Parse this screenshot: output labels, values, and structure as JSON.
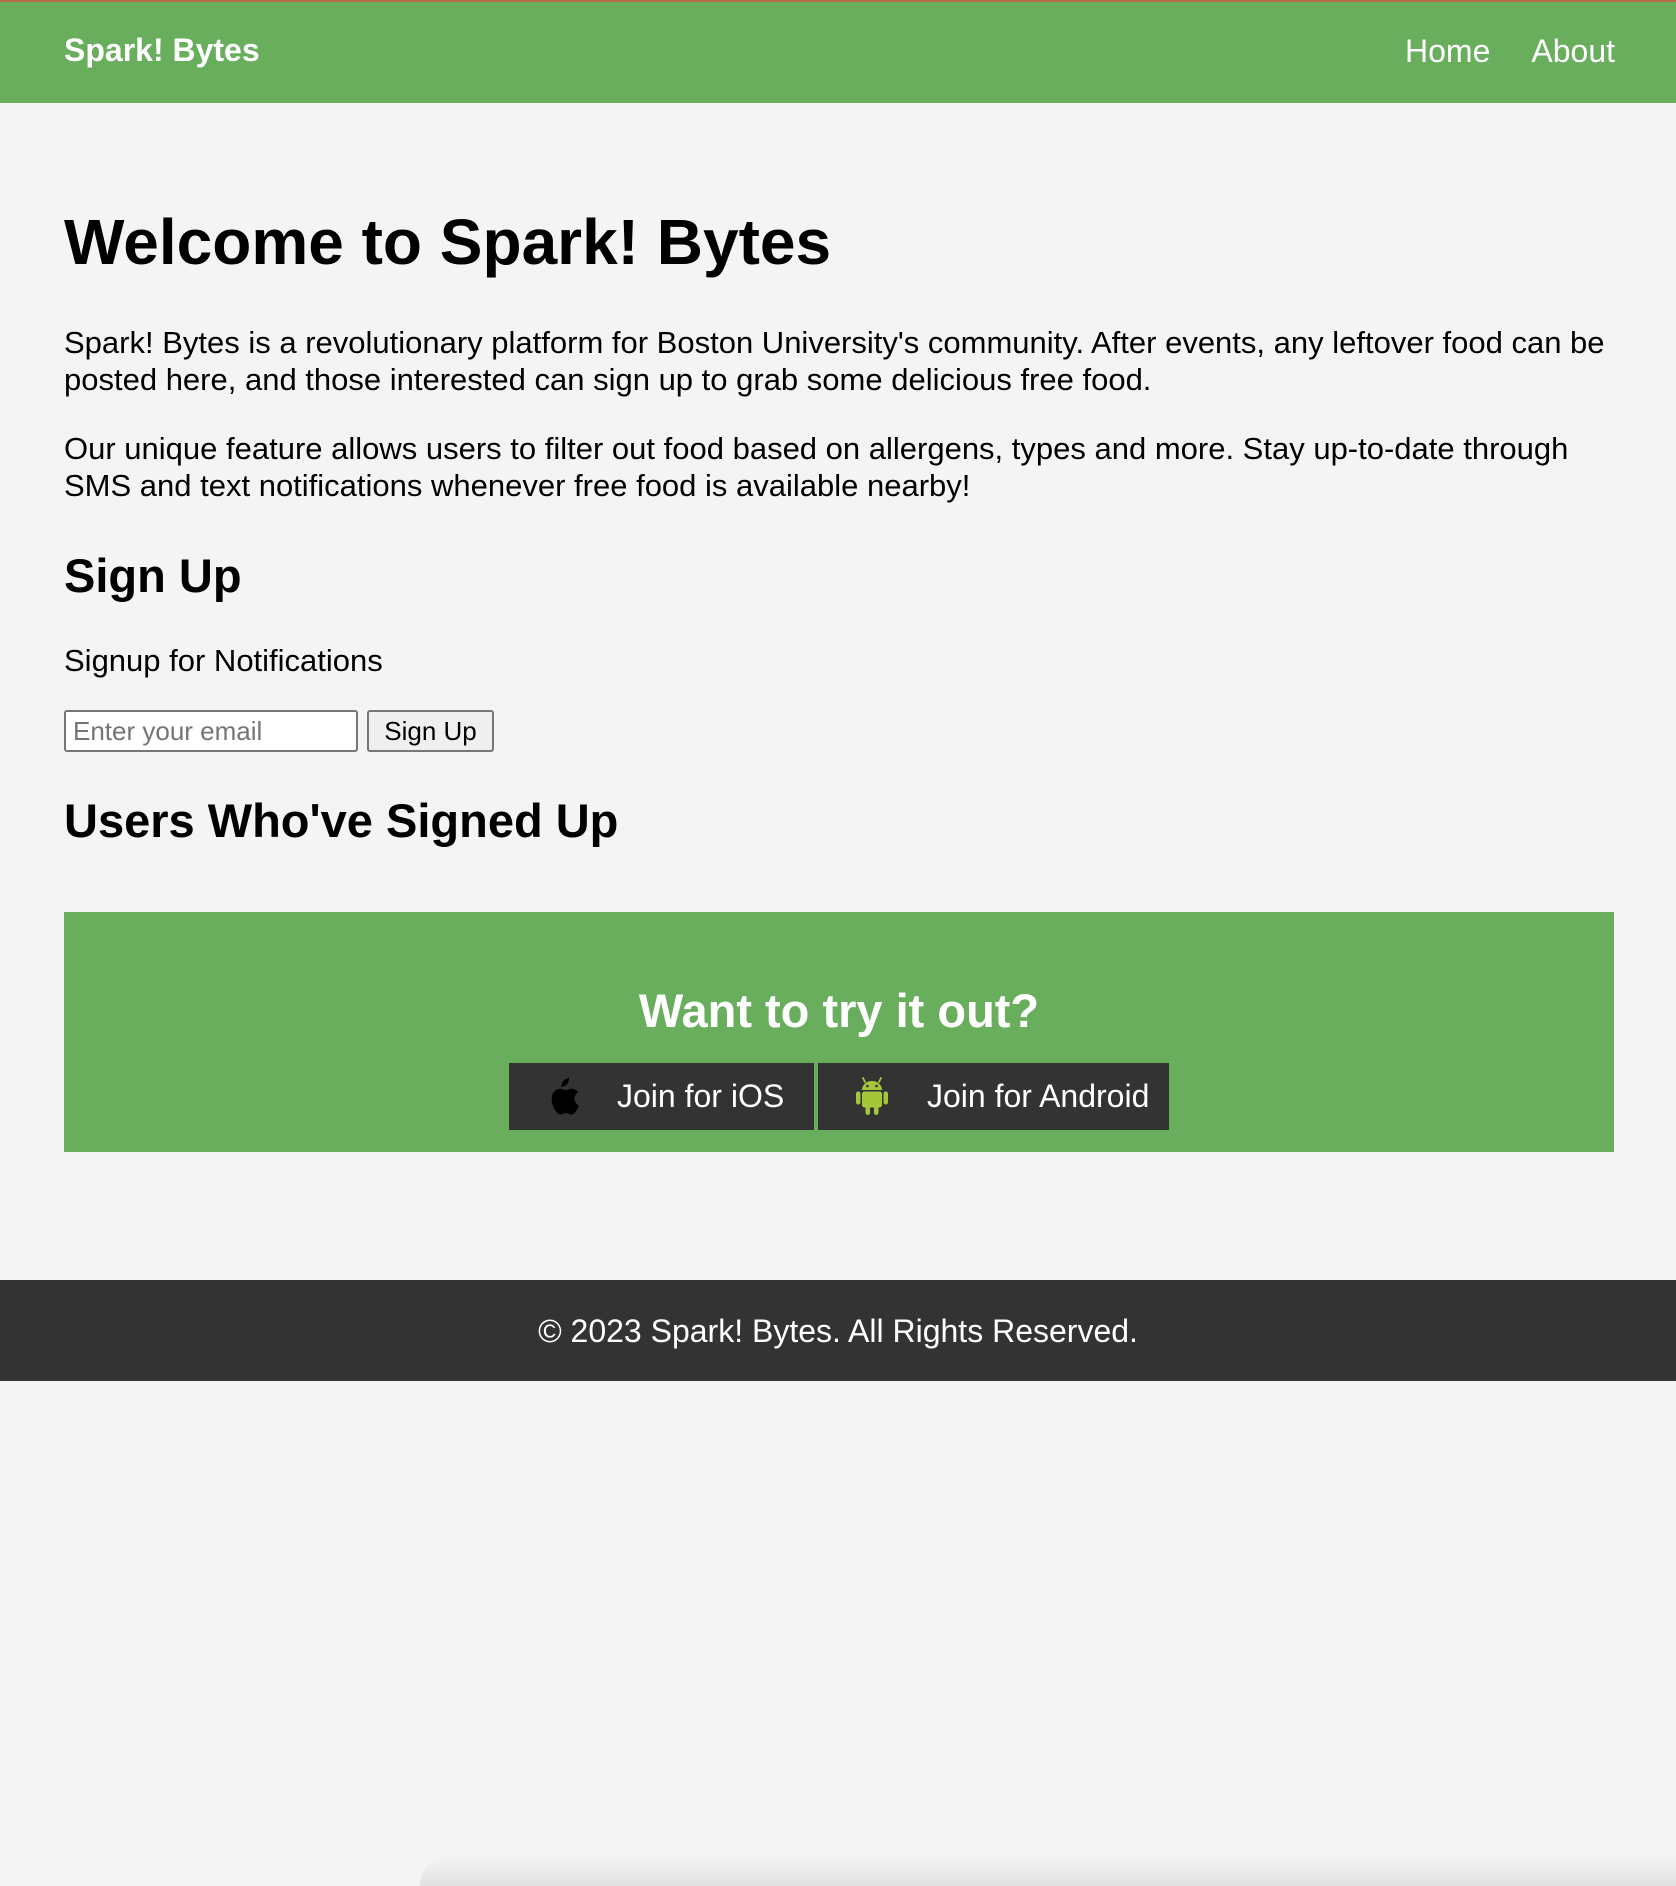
{
  "navbar": {
    "brand": "Spark! Bytes",
    "links": [
      {
        "label": "Home"
      },
      {
        "label": "About"
      }
    ],
    "color": "#69ae5d"
  },
  "main": {
    "title": "Welcome to Spark! Bytes",
    "paragraphs": [
      "Spark! Bytes is a revolutionary platform for Boston University's community. After events, any leftover food can be posted here, and those interested can sign up to grab some delicious free food.",
      "Our unique feature allows users to filter out food based on allergens, types and more. Stay up-to-date through SMS and text notifications whenever free food is available nearby!"
    ],
    "signup": {
      "heading": "Sign Up",
      "subheading": "Signup for Notifications",
      "email_placeholder": "Enter your email",
      "email_value": "",
      "button_label": "Sign Up"
    },
    "users_heading": "Users Who've Signed Up"
  },
  "cta": {
    "title": "Want to try it out?",
    "ios": {
      "label": "Join for iOS",
      "icon": "apple-icon"
    },
    "android": {
      "label": "Join for Android",
      "icon": "android-icon",
      "icon_color": "#a4c639"
    },
    "background": "#69ae5d",
    "button_color": "#333333"
  },
  "footer": {
    "text": "© 2023 Spark! Bytes. All Rights Reserved.",
    "background": "#333333"
  }
}
